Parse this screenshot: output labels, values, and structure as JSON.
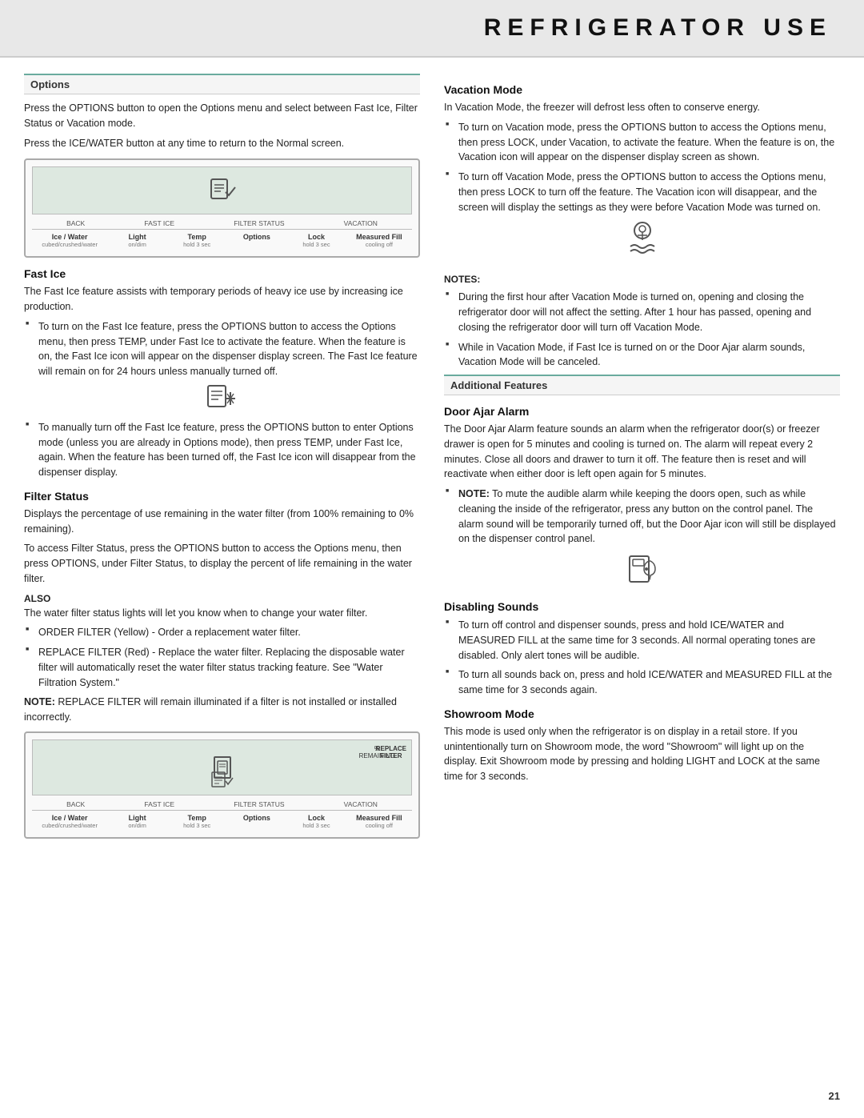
{
  "header": {
    "title": "REFRIGERATOR USE"
  },
  "left": {
    "options_section": {
      "title": "Options",
      "para1": "Press the OPTIONS button to open the Options menu and select between Fast Ice, Filter Status or Vacation mode.",
      "para2": "Press the ICE/WATER button at any time to return to the Normal screen."
    },
    "fast_ice": {
      "title": "Fast Ice",
      "intro": "The Fast Ice feature assists with temporary periods of heavy ice use by increasing ice production.",
      "bullet1": "To turn on the Fast Ice feature, press the OPTIONS button to access the Options menu, then press TEMP, under Fast Ice to activate the feature. When the feature is on, the Fast Ice icon will appear on the dispenser display screen. The Fast Ice feature will remain on for 24 hours unless manually turned off.",
      "bullet2": "To manually turn off the Fast Ice feature, press the OPTIONS button to enter Options mode (unless you are already in Options mode), then press TEMP, under Fast Ice, again. When the feature has been turned off, the Fast Ice icon will disappear from the dispenser display."
    },
    "filter_status": {
      "title": "Filter Status",
      "para1": "Displays the percentage of use remaining in the water filter (from 100% remaining to 0% remaining).",
      "para2": "To access Filter Status, press the OPTIONS button to access the Options menu, then press OPTIONS, under Filter Status, to display the percent of life remaining in the water filter.",
      "also_label": "ALSO",
      "also_text": "The water filter status lights will let you know when to change your water filter.",
      "bullet1": "ORDER FILTER (Yellow) - Order a replacement water filter.",
      "bullet2": "REPLACE FILTER (Red) - Replace the water filter. Replacing the disposable water filter will automatically reset the water filter status tracking feature. See \"Water Filtration System.\"",
      "note": "NOTE:",
      "note_text": "REPLACE FILTER will remain illuminated if a filter is not installed or installed incorrectly."
    },
    "panel1": {
      "screen_icon": "☰",
      "labels": [
        "BACK",
        "FAST ICE",
        "FILTER STATUS",
        "VACATION"
      ],
      "buttons": [
        {
          "top": "Ice / Water",
          "bottom": "cubed/crushed/water"
        },
        {
          "top": "Light",
          "bottom": "on/dim"
        },
        {
          "top": "Temp",
          "bottom": "hold 3 sec"
        },
        {
          "top": "Options",
          "bottom": ""
        },
        {
          "top": "Lock",
          "bottom": "hold 3 sec"
        },
        {
          "top": "Measured Fill",
          "bottom": "cooling off"
        }
      ]
    },
    "panel2": {
      "percent_label": "%\nREMAINING",
      "replace_filter": "REPLACE\nFILTER",
      "labels": [
        "BACK",
        "FAST ICE",
        "FILTER STATUS",
        "VACATION"
      ],
      "buttons": [
        {
          "top": "Ice / Water",
          "bottom": "cubed/crushed/water"
        },
        {
          "top": "Light",
          "bottom": "on/dim"
        },
        {
          "top": "Temp",
          "bottom": "hold 3 sec"
        },
        {
          "top": "Options",
          "bottom": ""
        },
        {
          "top": "Lock",
          "bottom": "hold 3 sec"
        },
        {
          "top": "Measured Fill",
          "bottom": "cooling off"
        }
      ]
    }
  },
  "right": {
    "vacation_mode": {
      "title": "Vacation Mode",
      "intro": "In Vacation Mode, the freezer will defrost less often to conserve energy.",
      "bullet1": "To turn on Vacation mode, press the OPTIONS button to access the Options menu, then press LOCK, under Vacation, to activate the feature. When the feature is on, the Vacation icon will appear on the dispenser display screen as shown.",
      "bullet2": "To turn off Vacation Mode, press the OPTIONS button to access the Options menu, then press LOCK to turn off the feature. The Vacation icon will disappear, and the screen will display the settings as they were before Vacation Mode was turned on.",
      "notes_label": "NOTES:",
      "note1": "During the first hour after Vacation Mode is turned on, opening and closing the refrigerator door will not affect the setting. After 1 hour has passed, opening and closing the refrigerator door will turn off Vacation Mode.",
      "note2": "While in Vacation Mode, if Fast Ice is turned on or the Door Ajar alarm sounds, Vacation Mode will be canceled."
    },
    "additional_features": {
      "title": "Additional Features"
    },
    "door_ajar": {
      "title": "Door Ajar Alarm",
      "para": "The Door Ajar Alarm feature sounds an alarm when the refrigerator door(s) or freezer drawer is open for 5 minutes and cooling is turned on. The alarm will repeat every 2 minutes. Close all doors and drawer to turn it off. The feature then is reset and will reactivate when either door is left open again for 5 minutes.",
      "bullet1_bold": "NOTE:",
      "bullet1": " To mute the audible alarm while keeping the doors open, such as while cleaning the inside of the refrigerator, press any button on the control panel. The alarm sound will be temporarily turned off, but the Door Ajar icon will still be displayed on the dispenser control panel."
    },
    "disabling_sounds": {
      "title": "Disabling Sounds",
      "bullet1": "To turn off control and dispenser sounds, press and hold ICE/WATER and MEASURED FILL at the same time for 3 seconds. All normal operating tones are disabled. Only alert tones will be audible.",
      "bullet2": "To turn all sounds back on, press and hold ICE/WATER and MEASURED FILL at the same time for 3 seconds again."
    },
    "showroom_mode": {
      "title": "Showroom Mode",
      "para": "This mode is used only when the refrigerator is on display in a retail store. If you unintentionally turn on Showroom mode, the word \"Showroom\" will light up on the display. Exit Showroom mode by pressing and holding LIGHT and LOCK at the same time for 3 seconds."
    }
  },
  "page_number": "21"
}
